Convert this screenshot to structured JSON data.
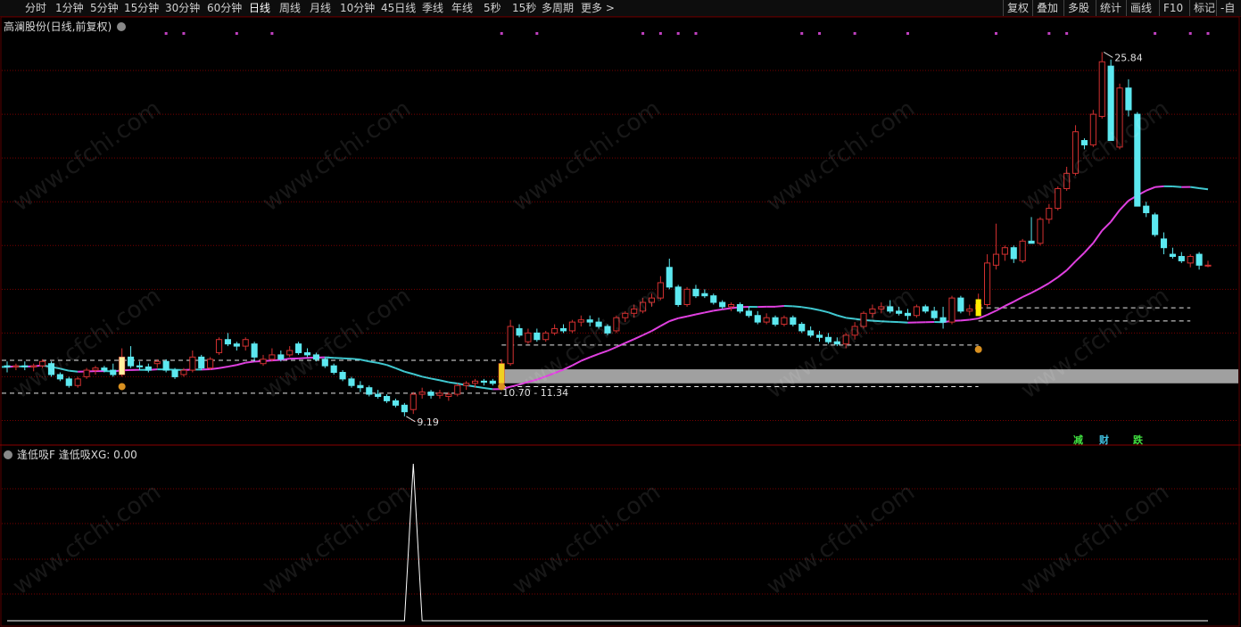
{
  "toolbar": {
    "periods": [
      "分时",
      "1分钟",
      "5分钟",
      "15分钟",
      "30分钟",
      "60分钟",
      "日线",
      "周线",
      "月线",
      "10分钟",
      "45日线",
      "季线",
      "年线",
      "5秒",
      "15秒",
      "多周期",
      "更多 >"
    ],
    "active_period": "日线",
    "right_buttons": [
      "复权",
      "叠加",
      "多股",
      "统计",
      "画线",
      "F10",
      "标记",
      "-自"
    ]
  },
  "main_panel": {
    "title": "高澜股份(日线,前复权)",
    "high_label": "25.84",
    "low_label": "9.19",
    "zone_label": "10.70 - 11.34",
    "signal_glyphs": [
      "减",
      "财",
      "跌"
    ]
  },
  "sub_panel": {
    "title": "逢低吸F  逢低吸XG: 0.00"
  },
  "watermark": "www.cfchi.com",
  "colors": {
    "up": "#d33030",
    "down": "#5ce8f0",
    "ma_rising": "#e040e0",
    "ma_falling": "#40c8d0",
    "grid": "#7a0000",
    "band": "#a0a0a0"
  },
  "chart_data": {
    "type": "candlestick",
    "y_range_main": [
      8.0,
      27.0
    ],
    "marked_high": 25.84,
    "marked_low": 9.19,
    "support_zone": [
      10.7,
      11.34
    ],
    "candles": [
      [
        11.5,
        11.7,
        11.2,
        11.45
      ],
      [
        11.45,
        11.6,
        11.3,
        11.5
      ],
      [
        11.5,
        11.7,
        11.3,
        11.45
      ],
      [
        11.45,
        11.6,
        11.25,
        11.5
      ],
      [
        11.5,
        11.8,
        11.4,
        11.7
      ],
      [
        11.6,
        11.7,
        11.0,
        11.1
      ],
      [
        11.1,
        11.2,
        10.8,
        10.9
      ],
      [
        10.9,
        11.0,
        10.5,
        10.6
      ],
      [
        10.6,
        11.0,
        10.5,
        10.9
      ],
      [
        11.0,
        11.4,
        10.9,
        11.3
      ],
      [
        11.3,
        11.5,
        11.1,
        11.4
      ],
      [
        11.4,
        11.5,
        11.2,
        11.3
      ],
      [
        11.3,
        11.6,
        11.0,
        11.1
      ],
      [
        11.1,
        12.3,
        11.0,
        11.9
      ],
      [
        11.9,
        12.4,
        11.4,
        11.5
      ],
      [
        11.5,
        11.7,
        11.3,
        11.45
      ],
      [
        11.45,
        11.6,
        11.2,
        11.3
      ],
      [
        11.6,
        11.8,
        11.4,
        11.7
      ],
      [
        11.7,
        11.8,
        11.2,
        11.3
      ],
      [
        11.3,
        11.4,
        10.9,
        11.0
      ],
      [
        11.1,
        11.4,
        11.0,
        11.3
      ],
      [
        11.3,
        12.2,
        11.2,
        11.9
      ],
      [
        11.9,
        12.0,
        11.3,
        11.4
      ],
      [
        11.4,
        11.9,
        11.3,
        11.8
      ],
      [
        12.1,
        12.8,
        12.0,
        12.7
      ],
      [
        12.7,
        13.0,
        12.4,
        12.5
      ],
      [
        12.5,
        12.6,
        12.2,
        12.4
      ],
      [
        12.4,
        12.8,
        12.2,
        12.7
      ],
      [
        12.5,
        12.6,
        11.7,
        11.9
      ],
      [
        11.6,
        12.0,
        11.5,
        11.8
      ],
      [
        11.8,
        12.3,
        11.7,
        12.0
      ],
      [
        12.0,
        12.2,
        11.7,
        11.8
      ],
      [
        12.0,
        12.4,
        11.9,
        12.2
      ],
      [
        12.5,
        12.6,
        12.0,
        12.1
      ],
      [
        12.1,
        12.3,
        11.9,
        12.0
      ],
      [
        12.0,
        12.1,
        11.7,
        11.8
      ],
      [
        11.8,
        11.9,
        11.4,
        11.5
      ],
      [
        11.5,
        11.6,
        11.1,
        11.2
      ],
      [
        11.2,
        11.3,
        10.8,
        10.9
      ],
      [
        10.9,
        11.0,
        10.5,
        10.6
      ],
      [
        10.6,
        10.8,
        10.3,
        10.5
      ],
      [
        10.5,
        10.6,
        10.1,
        10.2
      ],
      [
        10.2,
        10.4,
        10.0,
        10.1
      ],
      [
        10.1,
        10.2,
        9.8,
        9.9
      ],
      [
        9.9,
        10.0,
        9.6,
        9.7
      ],
      [
        9.7,
        9.8,
        9.19,
        9.4
      ],
      [
        9.5,
        10.3,
        9.3,
        10.2
      ],
      [
        10.2,
        10.5,
        10.0,
        10.3
      ],
      [
        10.3,
        10.4,
        10.0,
        10.15
      ],
      [
        10.15,
        10.4,
        10.0,
        10.25
      ],
      [
        10.1,
        10.3,
        9.9,
        10.2
      ],
      [
        10.2,
        10.7,
        10.1,
        10.6
      ],
      [
        10.6,
        10.8,
        10.4,
        10.7
      ],
      [
        10.7,
        10.9,
        10.5,
        10.8
      ],
      [
        10.8,
        10.9,
        10.6,
        10.75
      ],
      [
        10.8,
        10.9,
        10.6,
        10.7
      ],
      [
        10.7,
        11.8,
        10.6,
        11.6
      ],
      [
        11.6,
        13.6,
        11.5,
        13.3
      ],
      [
        13.2,
        13.4,
        12.8,
        12.9
      ],
      [
        12.6,
        13.2,
        12.5,
        13.0
      ],
      [
        13.0,
        13.2,
        12.6,
        12.7
      ],
      [
        12.7,
        13.1,
        12.6,
        13.0
      ],
      [
        13.0,
        13.4,
        12.9,
        13.2
      ],
      [
        13.2,
        13.4,
        13.0,
        13.1
      ],
      [
        13.1,
        13.6,
        13.0,
        13.5
      ],
      [
        13.5,
        13.8,
        13.3,
        13.6
      ],
      [
        13.6,
        13.8,
        13.3,
        13.5
      ],
      [
        13.5,
        13.7,
        13.2,
        13.3
      ],
      [
        13.3,
        13.4,
        12.9,
        13.0
      ],
      [
        13.1,
        13.8,
        13.0,
        13.7
      ],
      [
        13.7,
        14.0,
        13.5,
        13.9
      ],
      [
        13.9,
        14.3,
        13.7,
        14.1
      ],
      [
        14.0,
        14.6,
        13.9,
        14.4
      ],
      [
        14.4,
        14.8,
        14.2,
        14.6
      ],
      [
        14.6,
        15.6,
        14.5,
        15.3
      ],
      [
        16.0,
        16.4,
        15.0,
        15.1
      ],
      [
        15.1,
        15.2,
        14.2,
        14.3
      ],
      [
        14.3,
        15.1,
        14.2,
        15.0
      ],
      [
        15.0,
        15.2,
        14.6,
        14.7
      ],
      [
        14.8,
        15.0,
        14.6,
        14.7
      ],
      [
        14.7,
        14.8,
        14.3,
        14.4
      ],
      [
        14.4,
        14.5,
        14.1,
        14.2
      ],
      [
        14.2,
        14.4,
        14.0,
        14.3
      ],
      [
        14.3,
        14.4,
        13.9,
        14.0
      ],
      [
        14.0,
        14.2,
        13.7,
        13.8
      ],
      [
        13.8,
        14.0,
        13.4,
        13.5
      ],
      [
        13.5,
        13.9,
        13.4,
        13.7
      ],
      [
        13.7,
        13.8,
        13.3,
        13.4
      ],
      [
        13.4,
        13.8,
        13.3,
        13.7
      ],
      [
        13.7,
        13.8,
        13.3,
        13.4
      ],
      [
        13.4,
        13.5,
        13.0,
        13.1
      ],
      [
        13.1,
        13.3,
        12.8,
        12.9
      ],
      [
        12.9,
        13.1,
        12.6,
        12.8
      ],
      [
        12.8,
        13.0,
        12.5,
        12.6
      ],
      [
        12.6,
        12.8,
        12.4,
        12.5
      ],
      [
        12.5,
        13.0,
        12.3,
        12.9
      ],
      [
        12.9,
        13.5,
        12.7,
        13.3
      ],
      [
        13.3,
        14.0,
        13.2,
        13.9
      ],
      [
        13.9,
        14.3,
        13.7,
        14.1
      ],
      [
        14.1,
        14.4,
        13.9,
        14.2
      ],
      [
        14.2,
        14.5,
        13.9,
        14.0
      ],
      [
        14.0,
        14.2,
        13.8,
        13.9
      ],
      [
        13.9,
        14.1,
        13.6,
        13.8
      ],
      [
        13.8,
        14.3,
        13.7,
        14.2
      ],
      [
        14.2,
        14.3,
        13.9,
        14.0
      ],
      [
        14.0,
        14.2,
        13.6,
        13.7
      ],
      [
        13.7,
        14.2,
        13.2,
        13.5
      ],
      [
        13.5,
        14.7,
        13.4,
        14.6
      ],
      [
        14.6,
        14.7,
        13.9,
        14.0
      ],
      [
        14.0,
        14.3,
        13.8,
        14.1
      ],
      [
        14.1,
        14.8,
        14.0,
        14.3
      ],
      [
        14.3,
        16.6,
        14.2,
        16.2
      ],
      [
        16.1,
        18.0,
        15.9,
        16.6
      ],
      [
        16.6,
        17.0,
        16.3,
        16.9
      ],
      [
        16.9,
        17.0,
        16.2,
        16.4
      ],
      [
        16.3,
        17.3,
        16.2,
        17.2
      ],
      [
        17.2,
        18.3,
        17.1,
        17.1
      ],
      [
        17.1,
        18.3,
        17.0,
        18.2
      ],
      [
        18.2,
        18.9,
        18.0,
        18.7
      ],
      [
        18.7,
        19.7,
        18.6,
        19.6
      ],
      [
        19.6,
        20.6,
        19.5,
        20.3
      ],
      [
        20.3,
        22.5,
        20.2,
        22.2
      ],
      [
        21.8,
        21.9,
        21.4,
        21.6
      ],
      [
        21.6,
        23.2,
        21.5,
        23.0
      ],
      [
        22.9,
        25.84,
        22.8,
        25.4
      ],
      [
        25.2,
        25.5,
        21.8,
        21.8
      ],
      [
        21.5,
        24.4,
        21.4,
        24.2
      ],
      [
        24.2,
        24.6,
        22.9,
        23.2
      ],
      [
        23.0,
        23.1,
        18.8,
        18.8
      ],
      [
        18.8,
        19.0,
        18.3,
        18.5
      ],
      [
        18.4,
        18.5,
        17.4,
        17.5
      ],
      [
        17.3,
        17.6,
        16.6,
        16.9
      ],
      [
        16.6,
        16.9,
        16.4,
        16.5
      ],
      [
        16.5,
        16.7,
        16.2,
        16.3
      ],
      [
        16.2,
        16.6,
        16.0,
        16.5
      ],
      [
        16.6,
        16.7,
        15.9,
        16.1
      ],
      [
        16.1,
        16.3,
        16.0,
        16.1
      ]
    ],
    "indicator_XG": {
      "name": "逢低吸XG",
      "current_value": 0.0,
      "signal_index": 46,
      "signal_value": 1
    }
  }
}
